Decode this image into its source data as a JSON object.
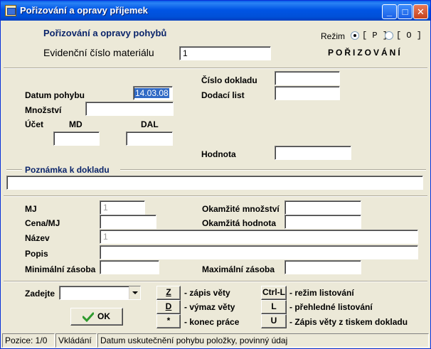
{
  "window": {
    "title": "Pořizování a opravy příjemek",
    "minimize_glyph": "_",
    "maximize_glyph": "□",
    "close_glyph": "✕"
  },
  "header": {
    "heading": "Pořizování a opravy pohybů",
    "mode_label": "Režim",
    "mode_option_p": "[ P ]",
    "mode_option_o": "[ O ]",
    "mode_selected": "P",
    "evidence_label": "Evidenční číslo materiálu",
    "evidence_value": "1",
    "mode_status": "POŘIZOVÁNÍ"
  },
  "movement": {
    "document_number_label": "Číslo dokladu",
    "document_number_value": "",
    "date_label": "Datum pohybu",
    "date_value": "14.03.08",
    "delivery_note_label": "Dodací list",
    "delivery_note_value": "",
    "quantity_label": "Množství",
    "quantity_value": "",
    "account_label": "Účet",
    "md_label": "MD",
    "md_value": "",
    "dal_label": "DAL",
    "dal_value": "",
    "value_label": "Hodnota",
    "value_value": ""
  },
  "note": {
    "label": "Poznámka k dokladu",
    "value": ""
  },
  "material": {
    "unit_label": "MJ",
    "unit_value": "1",
    "current_qty_label": "Okamžité množství",
    "current_qty_value": "",
    "price_label": "Cena/MJ",
    "price_value": "",
    "current_value_label": "Okamžitá hodnota",
    "current_value_value": "",
    "name_label": "Název",
    "name_value": "1",
    "description_label": "Popis",
    "description_value": "",
    "min_stock_label": "Minimální zásoba",
    "min_stock_value": "",
    "max_stock_label": "Maximální zásoba",
    "max_stock_value": ""
  },
  "footer": {
    "enter_label": "Zadejte",
    "enter_value": "",
    "ok_label": "OK",
    "shortcuts": [
      {
        "key": "Z",
        "desc": "- zápis věty"
      },
      {
        "key": "D",
        "desc": "- výmaz věty"
      },
      {
        "key": "*",
        "desc": "- konec práce"
      },
      {
        "key": "Ctrl-L",
        "desc": "- režim listování"
      },
      {
        "key": "L",
        "desc": "- přehledné listování"
      },
      {
        "key": "U",
        "desc": "- Zápis věty z tiskem dokladu"
      }
    ]
  },
  "statusbar": {
    "position": "Pozice: 1/0",
    "mode": "Vkládání",
    "message": "Datum uskutečnění pohybu položky, povinný údaj"
  },
  "colors": {
    "titlebar": "#0055e5",
    "face": "#ece9d8",
    "heading": "#0a246a",
    "ok_check": "#2e9a2e"
  }
}
